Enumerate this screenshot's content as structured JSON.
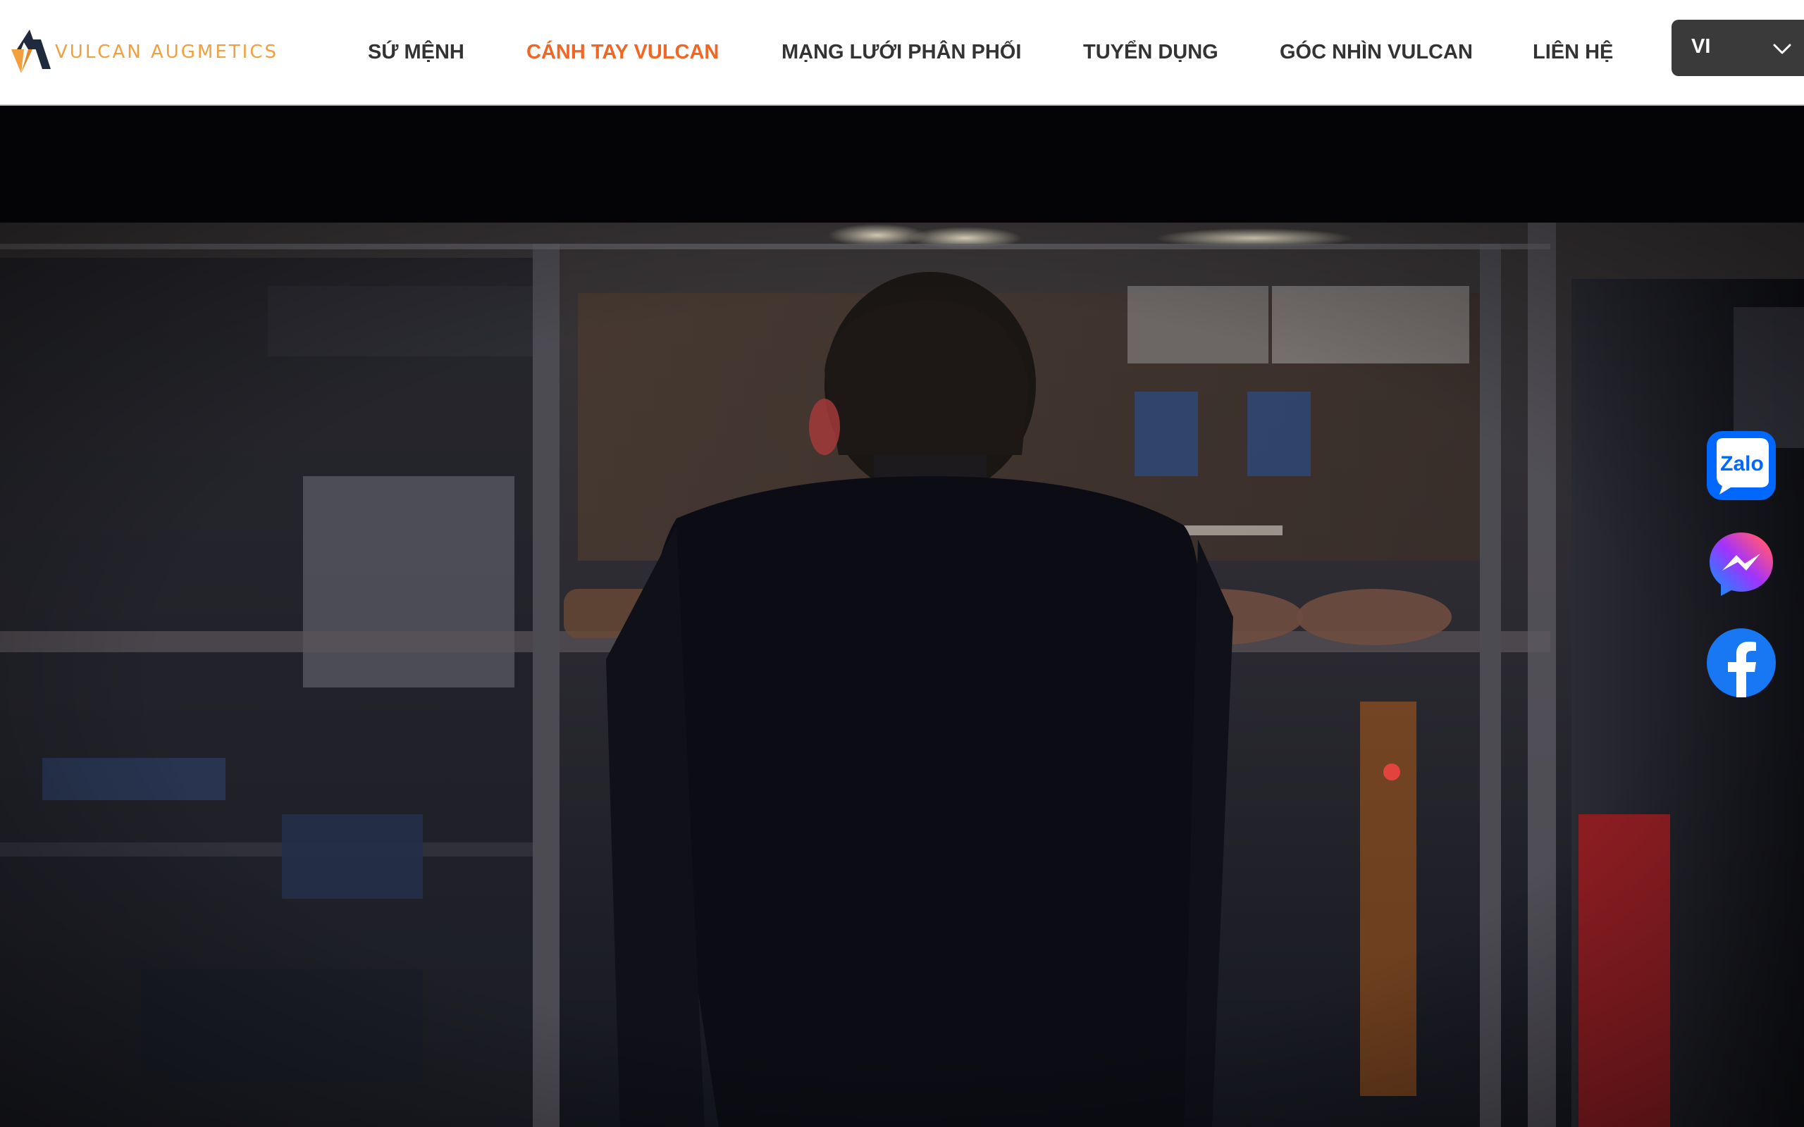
{
  "brand": {
    "name": "VULCAN AUGMETICS",
    "accent_color": "#f26522",
    "logo_color": "#f2a03d",
    "logo_icon": "vulcan-logo-icon"
  },
  "nav": {
    "items": [
      {
        "label": "SỨ MỆNH",
        "active": false
      },
      {
        "label": "CÁNH TAY VULCAN",
        "active": true
      },
      {
        "label": "MẠNG LƯỚI PHÂN PHỐI",
        "active": false
      },
      {
        "label": "TUYỂN DỤNG",
        "active": false
      },
      {
        "label": "GÓC NHÌN VULCAN",
        "active": false
      },
      {
        "label": "LIÊN HỆ",
        "active": false
      }
    ]
  },
  "language": {
    "selected": "VI",
    "icon": "chevron-down-icon"
  },
  "hero": {
    "media": "video-background",
    "description_icon": "workshop-scene"
  },
  "social": {
    "zalo": {
      "label": "Zalo",
      "color": "#0068ff"
    },
    "messenger": {
      "icon": "messenger-icon",
      "color": "#8a3ffc"
    },
    "facebook": {
      "icon": "facebook-icon",
      "color": "#1877f2"
    }
  }
}
